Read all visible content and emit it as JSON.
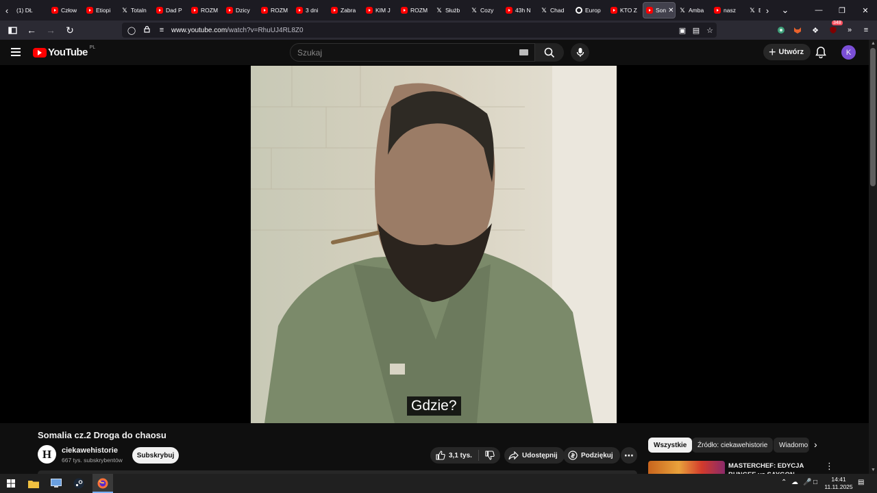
{
  "browser": {
    "tabs": [
      {
        "label": "(1) DŁ",
        "icon": "none"
      },
      {
        "label": "Człow",
        "icon": "youtube-icon"
      },
      {
        "label": "Etiopi",
        "icon": "youtube-icon"
      },
      {
        "label": "Totaln",
        "icon": "x-icon"
      },
      {
        "label": "Dad P",
        "icon": "youtube-icon"
      },
      {
        "label": "ROZM",
        "icon": "youtube-icon"
      },
      {
        "label": "Dzicy",
        "icon": "youtube-icon"
      },
      {
        "label": "ROZM",
        "icon": "youtube-icon"
      },
      {
        "label": "3 dni",
        "icon": "youtube-icon"
      },
      {
        "label": "Zabra",
        "icon": "youtube-icon"
      },
      {
        "label": "KIM J",
        "icon": "youtube-icon"
      },
      {
        "label": "ROZM",
        "icon": "youtube-icon"
      },
      {
        "label": "Służb",
        "icon": "x-icon"
      },
      {
        "label": "Cozy",
        "icon": "x-icon"
      },
      {
        "label": "43h N",
        "icon": "youtube-icon"
      },
      {
        "label": "Chad",
        "icon": "x-icon"
      },
      {
        "label": "Europ",
        "icon": "globe-icon"
      },
      {
        "label": "KTO Z",
        "icon": "youtube-icon"
      },
      {
        "label": "Son",
        "icon": "youtube-icon",
        "active": true
      },
      {
        "label": "Amba",
        "icon": "x-icon"
      },
      {
        "label": "nasz",
        "icon": "youtube-icon"
      },
      {
        "label": "Black",
        "icon": "x-icon"
      }
    ],
    "url_domain": "www.youtube.com",
    "url_path": "/watch?v=RhuUJ4RL8Z0",
    "extension_badge": "348"
  },
  "header": {
    "logo_text": "YouTube",
    "region": "PL",
    "search_placeholder": "Szukaj",
    "create_label": "Utwórz",
    "avatar_letter": "K"
  },
  "player": {
    "subtitle": "Gdzie?"
  },
  "video": {
    "title": "Somalia cz.2 Droga do chaosu",
    "channel_initial": "H",
    "channel_name": "ciekawehistorie",
    "subscribers": "667 tys. subskrybentów",
    "subscribe_label": "Subskrybuj",
    "likes": "3,1 tys.",
    "share_label": "Udostępnij",
    "thanks_label": "Podziękuj"
  },
  "sidebar": {
    "chips": [
      "Wszystkie",
      "Źródło: ciekawehistorie",
      "Wiadomo"
    ],
    "rec_title": "MASTERCHEF: EDYCJA BUNGEE vs SAYGON"
  },
  "taskbar": {
    "time": "14:41",
    "date": "11.11.2025"
  },
  "colors": {
    "yt_red": "#ff0000",
    "bg": "#0f0f0f",
    "avatar": "#7b4fd6"
  }
}
